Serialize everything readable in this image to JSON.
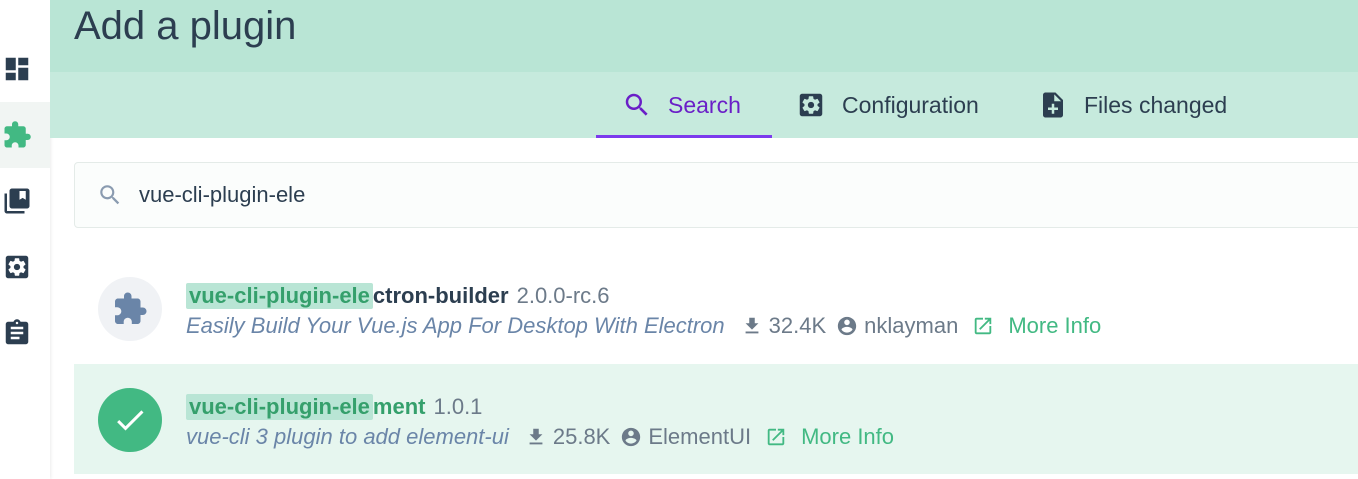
{
  "header": {
    "title": "Add a plugin"
  },
  "sidebar": {
    "items": [
      {
        "icon": "dashboard-icon"
      },
      {
        "icon": "puzzle-icon",
        "active": true
      },
      {
        "icon": "library-icon"
      },
      {
        "icon": "gear-icon"
      },
      {
        "icon": "clipboard-icon"
      }
    ]
  },
  "tabs": [
    {
      "label": "Search",
      "icon": "search-icon",
      "active": true
    },
    {
      "label": "Configuration",
      "icon": "gear-icon"
    },
    {
      "label": "Files changed",
      "icon": "file-plus-icon"
    }
  ],
  "search": {
    "value": "vue-cli-plugin-ele",
    "placeholder": "Search..."
  },
  "results": [
    {
      "highlight": "vue-cli-plugin-ele",
      "name_rest": "ctron-builder",
      "version": "2.0.0-rc.6",
      "description": "Easily Build Your Vue.js App For Desktop With Electron",
      "downloads": "32.4K",
      "author": "nklayman",
      "more_info": "More Info",
      "selected": false
    },
    {
      "highlight": "vue-cli-plugin-ele",
      "name_rest": "ment",
      "version": "1.0.1",
      "description": "vue-cli 3 plugin to add element-ui",
      "downloads": "25.8K",
      "author": "ElementUI",
      "more_info": "More Info",
      "selected": true
    }
  ],
  "colors": {
    "header_bg": "#b9e5d5",
    "tabs_bg": "#c6eadd",
    "accent_green": "#42b983",
    "active_tab": "#6a1fc7",
    "text": "#2c3e50"
  }
}
